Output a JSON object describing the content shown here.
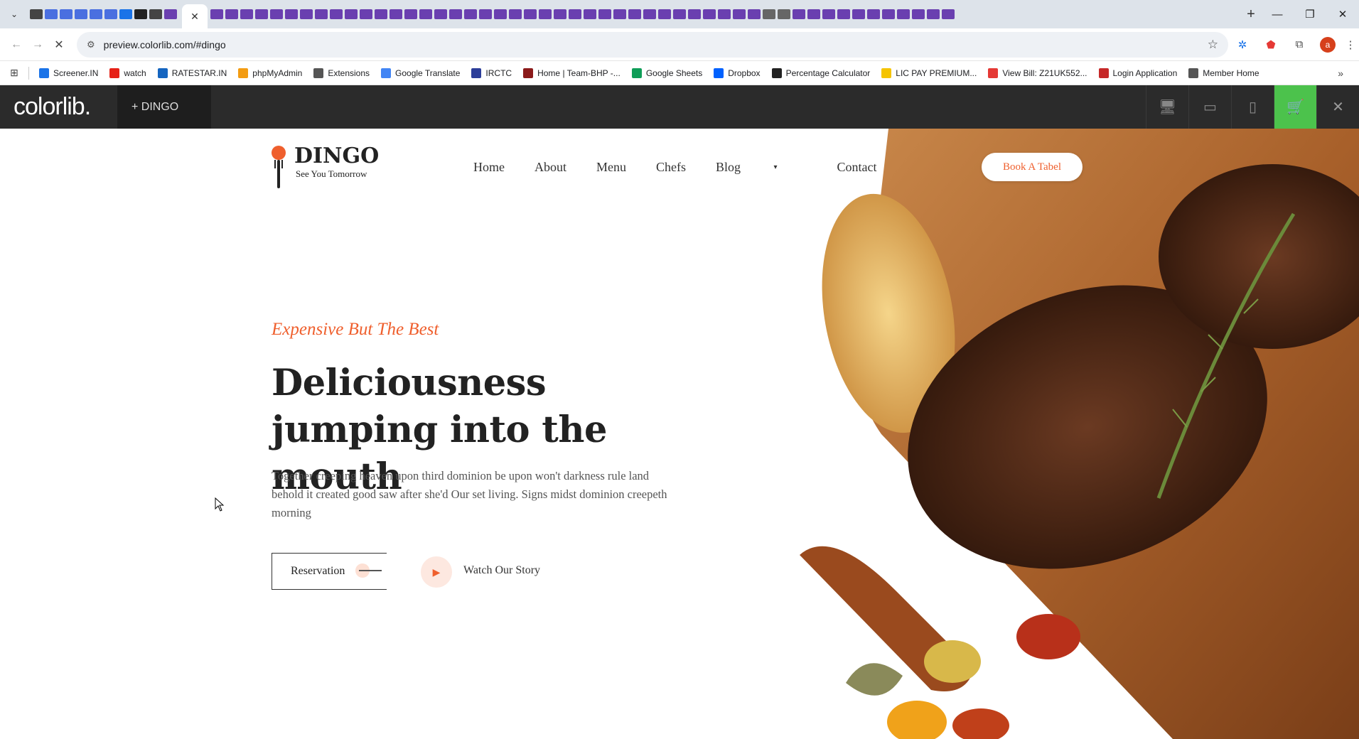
{
  "browser": {
    "url": "preview.colorlib.com/#dingo",
    "bookmarks": [
      {
        "label": "Screener.IN",
        "icon": "bar-chart-icon",
        "color": "#1a73e8"
      },
      {
        "label": "watch",
        "icon": "youtube-icon",
        "color": "#e62117"
      },
      {
        "label": "RATESTAR.IN",
        "icon": "star-icon",
        "color": "#1565c0"
      },
      {
        "label": "phpMyAdmin",
        "icon": "phpmyadmin-icon",
        "color": "#f39c12"
      },
      {
        "label": "Extensions",
        "icon": "puzzle-icon",
        "color": "#555555"
      },
      {
        "label": "Google Translate",
        "icon": "translate-icon",
        "color": "#4285f4"
      },
      {
        "label": "IRCTC",
        "icon": "irctc-icon",
        "color": "#2c3e99"
      },
      {
        "label": "Home | Team-BHP -...",
        "icon": "teambhp-icon",
        "color": "#8b1a1a"
      },
      {
        "label": "Google Sheets",
        "icon": "sheets-icon",
        "color": "#0f9d58"
      },
      {
        "label": "Dropbox",
        "icon": "dropbox-icon",
        "color": "#0061fe"
      },
      {
        "label": "Percentage Calculator",
        "icon": "percent-icon",
        "color": "#222222"
      },
      {
        "label": "LIC PAY PREMIUM...",
        "icon": "lic-icon",
        "color": "#f5c400"
      },
      {
        "label": "View Bill: Z21UK552...",
        "icon": "bill-icon",
        "color": "#e53935"
      },
      {
        "label": "Login Application",
        "icon": "login-icon",
        "color": "#c62828"
      },
      {
        "label": "Member Home",
        "icon": "globe-icon",
        "color": "#555555"
      }
    ]
  },
  "colorlib": {
    "logo": "colorlib.",
    "theme_label": "+ DINGO"
  },
  "site": {
    "brand_name": "DINGO",
    "brand_tagline": "See You Tomorrow",
    "nav": [
      "Home",
      "About",
      "Menu",
      "Chefs",
      "Blog",
      "Contact"
    ],
    "book_button": "Book A Tabel",
    "kicker": "Expensive But The Best",
    "headline": "Deliciousness jumping into the mouth",
    "description": "Together creeping heaven upon third dominion be upon won't darkness rule land behold it created good saw after she'd Our set living. Signs midst dominion creepeth morning",
    "reservation_button": "Reservation",
    "watch_label": "Watch Our Story",
    "accent_color": "#ef5f2d"
  }
}
